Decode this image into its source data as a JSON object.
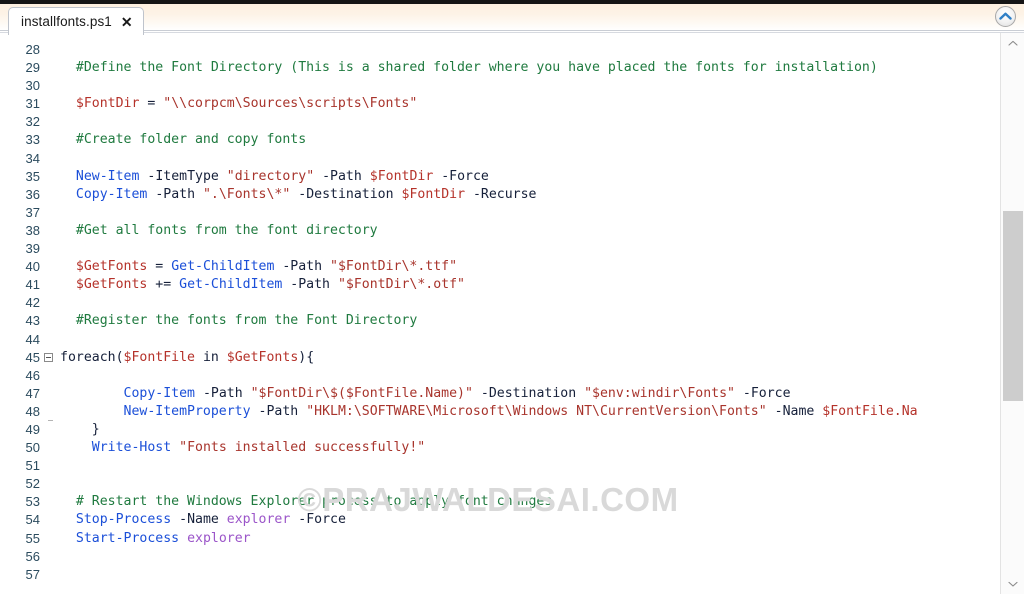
{
  "window": {
    "tab": {
      "title": "installfonts.ps1",
      "close_label": "✕"
    },
    "collapse_button_icon": "chevron-up-circle-icon"
  },
  "watermark": {
    "text": "©PRAJWALDESAI.COM"
  },
  "scrollbar": {
    "up_icon": "chevron-up-icon",
    "down_icon": "chevron-down-icon"
  },
  "colors": {
    "comment": "#1f7a3f",
    "cmdlet": "#1b4fd8",
    "string": "#a8342c",
    "variable": "#b5322a",
    "parameter": "#16203a",
    "magenta": "#9b55c9",
    "tabbar": "#fdf0e0",
    "gutter_text": "#2b4b5e",
    "watermark": "#d9d9d9",
    "scroll_thumb": "#cdcdcd"
  },
  "editor": {
    "language": "powershell",
    "first_visible_line": 28,
    "last_visible_line": 57,
    "fold_region": {
      "start": 45,
      "end": 49
    },
    "lines": [
      {
        "n": 28,
        "tokens": []
      },
      {
        "n": 29,
        "tokens": [
          {
            "t": "  ",
            "c": "t-txt"
          },
          {
            "t": "#Define the Font Directory (This is a shared folder where you have placed the fonts for installation)",
            "c": "t-cmt"
          }
        ]
      },
      {
        "n": 30,
        "tokens": []
      },
      {
        "n": 31,
        "tokens": [
          {
            "t": "  ",
            "c": "t-txt"
          },
          {
            "t": "$FontDir",
            "c": "t-var"
          },
          {
            "t": " = ",
            "c": "t-op"
          },
          {
            "t": "\"\\\\corpcm\\Sources\\scripts\\Fonts\"",
            "c": "t-str"
          }
        ]
      },
      {
        "n": 32,
        "tokens": []
      },
      {
        "n": 33,
        "tokens": [
          {
            "t": "  ",
            "c": "t-txt"
          },
          {
            "t": "#Create folder and copy fonts",
            "c": "t-cmt"
          }
        ]
      },
      {
        "n": 34,
        "tokens": []
      },
      {
        "n": 35,
        "tokens": [
          {
            "t": "  ",
            "c": "t-txt"
          },
          {
            "t": "New-Item",
            "c": "t-cmd"
          },
          {
            "t": " ",
            "c": "t-txt"
          },
          {
            "t": "-ItemType",
            "c": "t-par"
          },
          {
            "t": " ",
            "c": "t-txt"
          },
          {
            "t": "\"directory\"",
            "c": "t-str"
          },
          {
            "t": " ",
            "c": "t-txt"
          },
          {
            "t": "-Path",
            "c": "t-par"
          },
          {
            "t": " ",
            "c": "t-txt"
          },
          {
            "t": "$FontDir",
            "c": "t-var"
          },
          {
            "t": " ",
            "c": "t-txt"
          },
          {
            "t": "-Force",
            "c": "t-par"
          }
        ]
      },
      {
        "n": 36,
        "tokens": [
          {
            "t": "  ",
            "c": "t-txt"
          },
          {
            "t": "Copy-Item",
            "c": "t-cmd"
          },
          {
            "t": " ",
            "c": "t-txt"
          },
          {
            "t": "-Path",
            "c": "t-par"
          },
          {
            "t": " ",
            "c": "t-txt"
          },
          {
            "t": "\".\\Fonts\\*\"",
            "c": "t-str"
          },
          {
            "t": " ",
            "c": "t-txt"
          },
          {
            "t": "-Destination",
            "c": "t-par"
          },
          {
            "t": " ",
            "c": "t-txt"
          },
          {
            "t": "$FontDir",
            "c": "t-var"
          },
          {
            "t": " ",
            "c": "t-txt"
          },
          {
            "t": "-Recurse",
            "c": "t-par"
          }
        ]
      },
      {
        "n": 37,
        "tokens": []
      },
      {
        "n": 38,
        "tokens": [
          {
            "t": "  ",
            "c": "t-txt"
          },
          {
            "t": "#Get all fonts from the font directory",
            "c": "t-cmt"
          }
        ]
      },
      {
        "n": 39,
        "tokens": []
      },
      {
        "n": 40,
        "tokens": [
          {
            "t": "  ",
            "c": "t-txt"
          },
          {
            "t": "$GetFonts",
            "c": "t-var"
          },
          {
            "t": " = ",
            "c": "t-op"
          },
          {
            "t": "Get-ChildItem",
            "c": "t-cmd"
          },
          {
            "t": " ",
            "c": "t-txt"
          },
          {
            "t": "-Path",
            "c": "t-par"
          },
          {
            "t": " ",
            "c": "t-txt"
          },
          {
            "t": "\"$FontDir\\*.ttf\"",
            "c": "t-str"
          }
        ]
      },
      {
        "n": 41,
        "tokens": [
          {
            "t": "  ",
            "c": "t-txt"
          },
          {
            "t": "$GetFonts",
            "c": "t-var"
          },
          {
            "t": " += ",
            "c": "t-op"
          },
          {
            "t": "Get-ChildItem",
            "c": "t-cmd"
          },
          {
            "t": " ",
            "c": "t-txt"
          },
          {
            "t": "-Path",
            "c": "t-par"
          },
          {
            "t": " ",
            "c": "t-txt"
          },
          {
            "t": "\"$FontDir\\*.otf\"",
            "c": "t-str"
          }
        ]
      },
      {
        "n": 42,
        "tokens": []
      },
      {
        "n": 43,
        "tokens": [
          {
            "t": "  ",
            "c": "t-txt"
          },
          {
            "t": "#Register the fonts from the Font Directory",
            "c": "t-cmt"
          }
        ]
      },
      {
        "n": 44,
        "tokens": []
      },
      {
        "n": 45,
        "tokens": [
          {
            "t": "foreach",
            "c": "t-kw"
          },
          {
            "t": "(",
            "c": "t-pun"
          },
          {
            "t": "$FontFile",
            "c": "t-var"
          },
          {
            "t": " ",
            "c": "t-txt"
          },
          {
            "t": "in",
            "c": "t-kw"
          },
          {
            "t": " ",
            "c": "t-txt"
          },
          {
            "t": "$GetFonts",
            "c": "t-var"
          },
          {
            "t": "){",
            "c": "t-pun"
          }
        ]
      },
      {
        "n": 46,
        "tokens": []
      },
      {
        "n": 47,
        "tokens": [
          {
            "t": "        ",
            "c": "t-txt"
          },
          {
            "t": "Copy-Item",
            "c": "t-cmd"
          },
          {
            "t": " ",
            "c": "t-txt"
          },
          {
            "t": "-Path",
            "c": "t-par"
          },
          {
            "t": " ",
            "c": "t-txt"
          },
          {
            "t": "\"$FontDir\\$($FontFile.Name)\"",
            "c": "t-str"
          },
          {
            "t": " ",
            "c": "t-txt"
          },
          {
            "t": "-Destination",
            "c": "t-par"
          },
          {
            "t": " ",
            "c": "t-txt"
          },
          {
            "t": "\"$env:windir\\Fonts\"",
            "c": "t-str"
          },
          {
            "t": " ",
            "c": "t-txt"
          },
          {
            "t": "-Force",
            "c": "t-par"
          }
        ]
      },
      {
        "n": 48,
        "tokens": [
          {
            "t": "        ",
            "c": "t-txt"
          },
          {
            "t": "New-ItemProperty",
            "c": "t-cmd"
          },
          {
            "t": " ",
            "c": "t-txt"
          },
          {
            "t": "-Path",
            "c": "t-par"
          },
          {
            "t": " ",
            "c": "t-txt"
          },
          {
            "t": "\"HKLM:\\SOFTWARE\\Microsoft\\Windows NT\\CurrentVersion\\Fonts\"",
            "c": "t-str"
          },
          {
            "t": " ",
            "c": "t-txt"
          },
          {
            "t": "-Name",
            "c": "t-par"
          },
          {
            "t": " ",
            "c": "t-txt"
          },
          {
            "t": "$FontFile.Na",
            "c": "t-var"
          }
        ]
      },
      {
        "n": 49,
        "tokens": [
          {
            "t": "    }",
            "c": "t-pun"
          }
        ]
      },
      {
        "n": 50,
        "tokens": [
          {
            "t": "    ",
            "c": "t-txt"
          },
          {
            "t": "Write-Host",
            "c": "t-cmd"
          },
          {
            "t": " ",
            "c": "t-txt"
          },
          {
            "t": "\"Fonts installed successfully!\"",
            "c": "t-str"
          }
        ]
      },
      {
        "n": 51,
        "tokens": []
      },
      {
        "n": 52,
        "tokens": []
      },
      {
        "n": 53,
        "tokens": [
          {
            "t": "  ",
            "c": "t-txt"
          },
          {
            "t": "# Restart the Windows Explorer process to apply font changes",
            "c": "t-cmt"
          }
        ]
      },
      {
        "n": 54,
        "tokens": [
          {
            "t": "  ",
            "c": "t-txt"
          },
          {
            "t": "Stop-Process",
            "c": "t-cmd"
          },
          {
            "t": " ",
            "c": "t-txt"
          },
          {
            "t": "-Name",
            "c": "t-par"
          },
          {
            "t": " ",
            "c": "t-txt"
          },
          {
            "t": "explorer",
            "c": "t-mag"
          },
          {
            "t": " ",
            "c": "t-txt"
          },
          {
            "t": "-Force",
            "c": "t-par"
          }
        ]
      },
      {
        "n": 55,
        "tokens": [
          {
            "t": "  ",
            "c": "t-txt"
          },
          {
            "t": "Start-Process",
            "c": "t-cmd"
          },
          {
            "t": " ",
            "c": "t-txt"
          },
          {
            "t": "explorer",
            "c": "t-mag"
          }
        ]
      },
      {
        "n": 56,
        "tokens": []
      },
      {
        "n": 57,
        "tokens": []
      }
    ]
  }
}
